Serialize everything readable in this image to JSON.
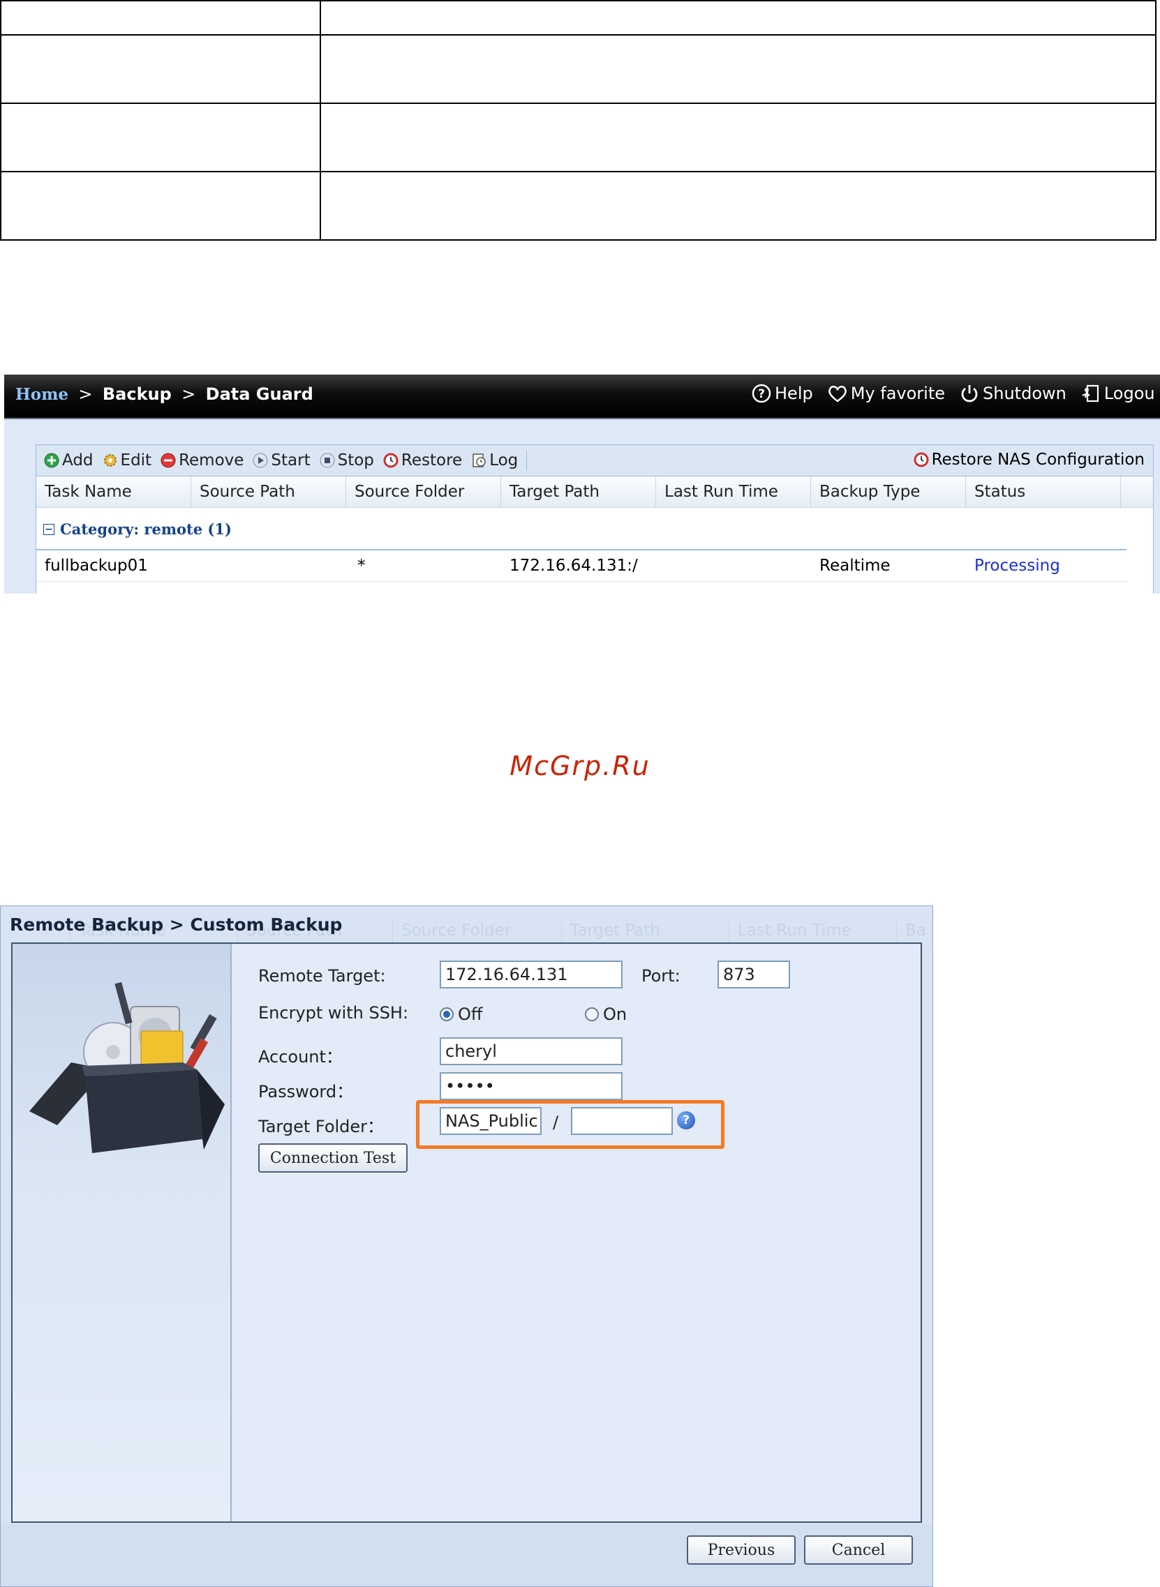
{
  "watermark": "McGrp.Ru",
  "data_guard": {
    "breadcrumb": {
      "home": "Home",
      "sep1": ">",
      "backup": "Backup",
      "sep2": ">",
      "page": "Data Guard"
    },
    "header_links": [
      {
        "label": "Help",
        "icon": "help-icon"
      },
      {
        "label": "My favorite",
        "icon": "heart-icon"
      },
      {
        "label": "Shutdown",
        "icon": "power-icon"
      },
      {
        "label": "Logou",
        "icon": "logout-icon"
      }
    ],
    "toolbar": {
      "add": "Add",
      "edit": "Edit",
      "remove": "Remove",
      "start": "Start",
      "stop": "Stop",
      "restore": "Restore",
      "log": "Log",
      "restore_nas": "Restore NAS Configuration"
    },
    "columns": [
      "Task Name",
      "Source Path",
      "Source Folder",
      "Target Path",
      "Last Run Time",
      "Backup Type",
      "Status"
    ],
    "category": "Category: remote (1)",
    "rows": [
      {
        "task_name": "fullbackup01",
        "source_path": "",
        "source_folder": "*",
        "target_path": "172.16.64.131:/",
        "last_run_time": "",
        "backup_type": "Realtime",
        "status": "Processing"
      }
    ]
  },
  "remote_backup": {
    "title": "Remote Backup > Custom Backup",
    "ghost_columns": [
      "Task Name",
      "Source Path",
      "Source Folder",
      "Target Path",
      "Last Run Time",
      "Ba"
    ],
    "labels": {
      "remote_target": "Remote Target:",
      "port": "Port:",
      "encrypt": "Encrypt with SSH:",
      "account": "Account：",
      "password": "Password：",
      "target_folder": "Target Folder：",
      "slash": "/"
    },
    "values": {
      "remote_target": "172.16.64.131",
      "port": "873",
      "account": "cheryl",
      "password": "•••••",
      "target_folder": "NAS_Public",
      "subfolder": ""
    },
    "ssh_options": {
      "off": "Off",
      "on": "On",
      "selected": "off"
    },
    "buttons": {
      "connection_test": "Connection Test",
      "previous": "Previous",
      "cancel": "Cancel",
      "help": "?"
    },
    "colors": {
      "highlight": "#f47a25",
      "accent": "#15428b"
    }
  }
}
